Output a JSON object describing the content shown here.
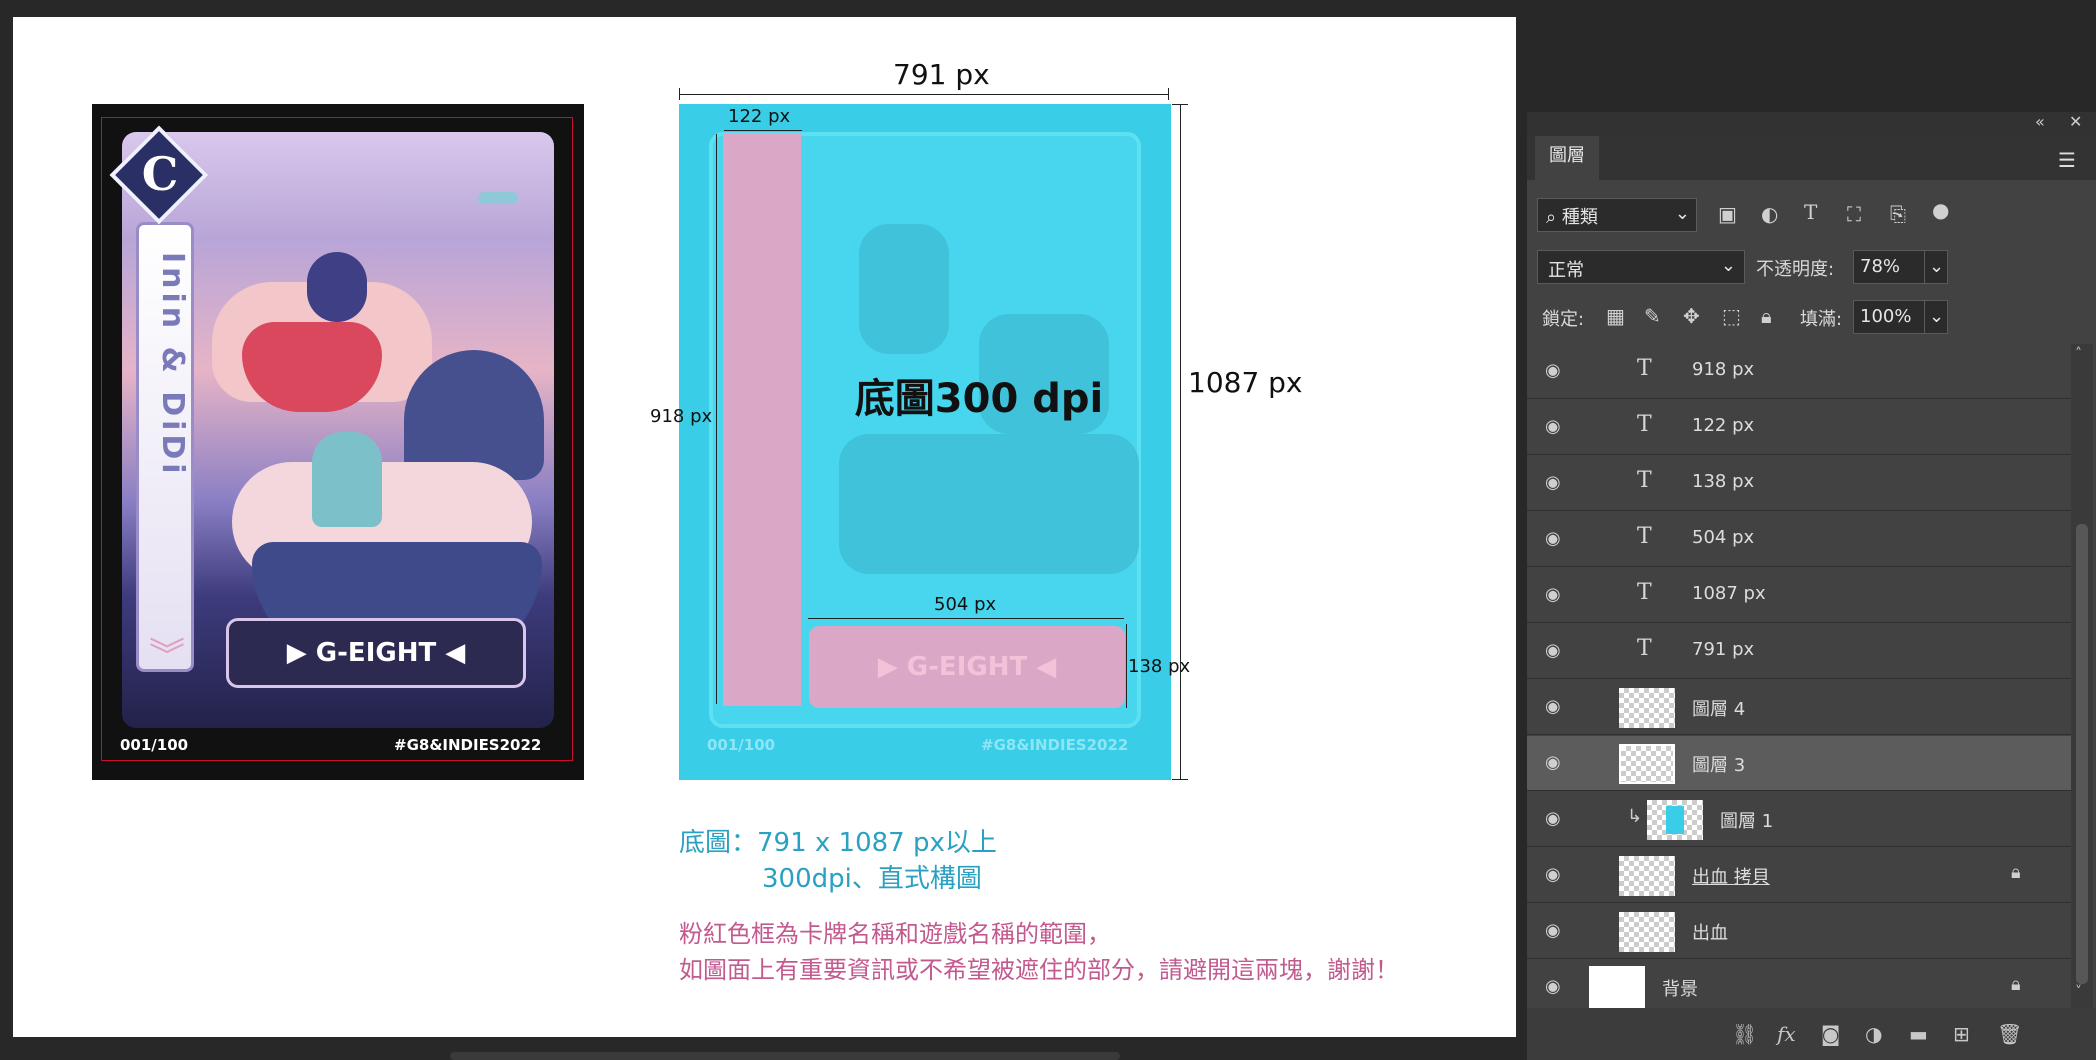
{
  "left_card": {
    "badge_letter": "C",
    "side_title": "Inin & DiDi",
    "name_box": "▶ G-EIGHT ◀",
    "serial": "001/100",
    "hashtag": "#G8&INDIES2022"
  },
  "template_card": {
    "center_label": "底圖300 dpi",
    "pink_box_text": "▶ G-EIGHT ◀",
    "serial": "001/100",
    "hashtag": "#G8&INDIES2022",
    "dimensions": {
      "width": "791 px",
      "height": "1087 px",
      "left_bar_width": "122 px",
      "left_bar_height": "918 px",
      "bottom_box_width": "504 px",
      "bottom_box_height": "138 px"
    }
  },
  "notes": {
    "line1": "底圖：791 x 1087 px以上",
    "line2": "300dpi、直式構圖",
    "pink_line1": "粉紅色框為卡牌名稱和遊戲名稱的範圍，",
    "pink_line2": "如圖面上有重要資訊或不希望被遮住的部分，請避開這兩塊，謝謝！"
  },
  "layers_panel": {
    "tab_label": "圖層",
    "filter_label": "種類",
    "blend_mode": "正常",
    "opacity_label": "不透明度:",
    "opacity_value": "78%",
    "lock_label": "鎖定:",
    "fill_label": "填滿:",
    "fill_value": "100%",
    "layers": [
      {
        "name": "918 px",
        "type": "text"
      },
      {
        "name": "122 px",
        "type": "text"
      },
      {
        "name": "138 px",
        "type": "text"
      },
      {
        "name": "504 px",
        "type": "text"
      },
      {
        "name": "1087 px",
        "type": "text"
      },
      {
        "name": "791 px",
        "type": "text"
      },
      {
        "name": "圖層 4",
        "type": "pixel"
      },
      {
        "name": "圖層 3",
        "type": "pixel",
        "selected": true
      },
      {
        "name": "圖層 1",
        "type": "pixel",
        "clipped": true
      },
      {
        "name": "出血 拷貝",
        "type": "pixel",
        "locked": true
      },
      {
        "name": "出血",
        "type": "pixel"
      },
      {
        "name": "背景",
        "type": "background",
        "locked": true
      }
    ]
  },
  "colors": {
    "template_cyan": "#39cde8",
    "pink_zone": "#e3a4c4",
    "bleed_red": "#c8102e",
    "note_blue": "#2aa1c2",
    "note_pink": "#c35a8f"
  }
}
